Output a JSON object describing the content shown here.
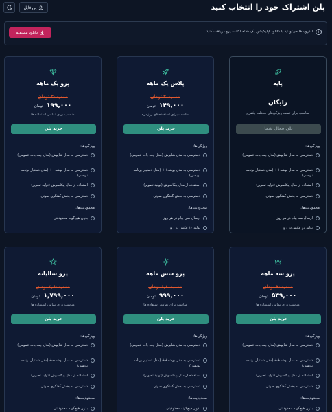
{
  "header": {
    "title": "پلن اشتراک خود را انتخاب کنید",
    "profile_label": "پروفایل"
  },
  "notice": {
    "text": "اندرویدها می‌توانید با دانلود اپلیکیشن یک هفته اکانت پرو دریافت کنید.",
    "download_label": "دانلود مستقیم"
  },
  "plans": [
    {
      "name": "پایه",
      "icon": "leaf-icon",
      "price_label": "رایگان",
      "desc": "مناسب برای تست ویژگی‌های مختلف پلتفرم",
      "button": "پلن فعال شما",
      "features_title": "ویژگی‌ها:",
      "features": [
        "دسترسی به مدل شایوش (مدل چت بات عمومی)",
        "دسترسی به مدل بوشه‌++ (مدل دستیار برنامه نویسی)",
        "استفاده از مدل پیکاسوش (تولید تصویر)",
        "دسترسی به بخش گفتگوی صوتی"
      ],
      "limits_title": "محدودیت‌ها:",
      "limits": [
        "ارسال سه پیام در هر روز",
        "تولید دو عکس در روز"
      ]
    },
    {
      "name": "پلاس یک ماهه",
      "icon": "rocket-icon",
      "old_price": "۳۰۰,۰۰۰ تومان",
      "price": "۱۴۹,۰۰۰",
      "currency": "تومان",
      "desc": "مناسب برای استفاده‌های روزمره",
      "button": "خرید پلن",
      "features_title": "ویژگی‌ها:",
      "features": [
        "دسترسی به مدل شایوش (مدل چت بات عمومی)",
        "دسترسی به مدل بوشه‌++ (مدل دستیار برنامه نویسی)",
        "استفاده از مدل پیکاسوش (تولید تصویر)",
        "دسترسی به بخش گفتگوی صوتی"
      ],
      "limits_title": "محدودیت‌ها:",
      "limits": [
        "ارسال سی پیام در هر روز",
        "تولید ۱۰ عکس در روز"
      ]
    },
    {
      "name": "پرو یک ماهه",
      "icon": "diamond-icon",
      "old_price": "۳۰۰,۰۰۰ تومان",
      "price": "۱۹۹,۰۰۰",
      "currency": "تومان",
      "desc": "مناسب برای تمامی استفاده ها",
      "button": "خرید پلن",
      "features_title": "ویژگی‌ها:",
      "features": [
        "دسترسی به مدل شایوش (مدل چت بات عمومی)",
        "دسترسی به مدل بوشه‌++ (مدل دستیار برنامه نویسی)",
        "استفاده از مدل پیکاسوش (تولید تصویر)",
        "دسترسی به بخش گفتگوی صوتی"
      ],
      "limits_title": "محدودیت‌ها:",
      "limits": [
        "بدون هیچ‌گونه محدودیتی"
      ]
    },
    {
      "name": "پرو سه ماهه",
      "icon": "crown-icon",
      "old_price": "۹۰۰,۰۰۰ تومان",
      "price": "۵۳۹,۰۰۰",
      "currency": "تومان",
      "desc": "مناسب برای تمامی استفاده ها",
      "button": "خرید پلن",
      "features_title": "ویژگی‌ها:",
      "features": [
        "دسترسی به مدل شایوش (مدل چت بات عمومی)",
        "دسترسی به مدل بوشه‌++ (مدل دستیار برنامه نویسی)",
        "استفاده از مدل پیکاسوش (تولید تصویر)",
        "دسترسی به بخش گفتگوی صوتی"
      ],
      "limits_title": "محدودیت‌ها:",
      "limits": [
        "بدون هیچ‌گونه محدودیتی"
      ]
    },
    {
      "name": "پرو شش ماهه",
      "icon": "sparkle-icon",
      "old_price": "۱,۸۰۰,۰۰۰ تومان",
      "price": "۹۹۹,۰۰۰",
      "currency": "تومان",
      "desc": "مناسب برای تمامی استفاده ها",
      "button": "خرید پلن",
      "features_title": "ویژگی‌ها:",
      "features": [
        "دسترسی به مدل شایوش (مدل چت بات عمومی)",
        "دسترسی به مدل بوشه‌++ (مدل دستیار برنامه نویسی)",
        "استفاده از مدل پیکاسوش (تولید تصویر)",
        "دسترسی به بخش گفتگوی صوتی"
      ],
      "limits_title": "محدودیت‌ها:",
      "limits": [
        "بدون هیچ‌گونه محدودیتی"
      ]
    },
    {
      "name": "پرو سالیانه",
      "icon": "star-icon",
      "old_price": "۳,۶۰۰,۰۰۰ تومان",
      "price": "۱,۷۹۹,۰۰۰",
      "currency": "تومان",
      "desc": "مناسب برای تمامی استفاده ها",
      "button": "خرید پلن",
      "features_title": "ویژگی‌ها:",
      "features": [
        "دسترسی به مدل شایوش (مدل چت بات عمومی)",
        "دسترسی به مدل بوشه‌++ (مدل دستیار برنامه نویسی)",
        "استفاده از مدل پیکاسوش (تولید تصویر)",
        "دسترسی به بخش گفتگوی صوتی"
      ],
      "limits_title": "محدودیت‌ها:",
      "limits": [
        "بدون هیچ‌گونه محدودیتی"
      ]
    }
  ],
  "colors": {
    "background": "#0d1524",
    "card": "#0f1a33",
    "accent": "#2f8f7f",
    "download": "#c2245c",
    "old_price": "#e0582f"
  }
}
